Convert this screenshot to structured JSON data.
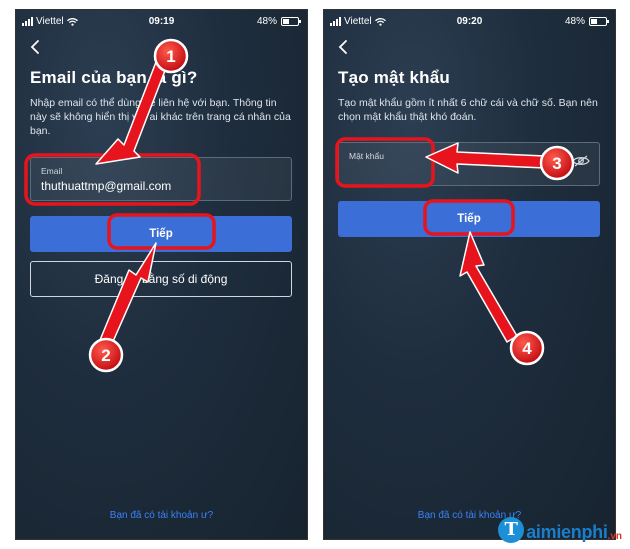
{
  "left": {
    "status": {
      "carrier": "Viettel",
      "time": "09:19",
      "battery": "48%",
      "battery_level": 0.48
    },
    "title": "Email của bạn là gì?",
    "description": "Nhập email có thể dùng để liên hệ với bạn. Thông tin này sẽ không hiển thị với ai khác trên trang cá nhân của bạn.",
    "email_field": {
      "label": "Email",
      "value": "thuthuattmp@gmail.com"
    },
    "next_button": "Tiếp",
    "phone_button": "Đăng ký bằng số di động",
    "footer_link": "Bạn đã có tài khoản ư?"
  },
  "right": {
    "status": {
      "carrier": "Viettel",
      "time": "09:20",
      "battery": "48%",
      "battery_level": 0.48
    },
    "title": "Tạo mật khẩu",
    "description": "Tạo mật khẩu gồm ít nhất 6 chữ cái và chữ số. Bạn nên chọn mật khẩu thật khó đoán.",
    "password_field": {
      "label": "Mật khẩu"
    },
    "next_button": "Tiếp",
    "footer_link": "Bạn đã có tài khoản ư?"
  },
  "annotations": {
    "steps": [
      "1",
      "2",
      "3",
      "4"
    ],
    "highlight_color": "#e8141d"
  },
  "watermark": {
    "brand": "aimienphi",
    "letter": "T",
    "tld": ".vn"
  },
  "colors": {
    "primary_button": "#3b6ed6",
    "link": "#3b82f6",
    "background": "#1e2d3d"
  }
}
